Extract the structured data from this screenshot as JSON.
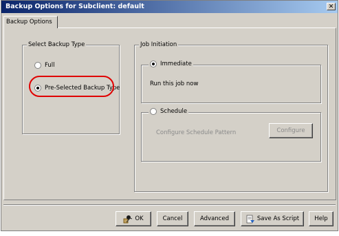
{
  "window": {
    "title": "Backup Options for Subclient: default",
    "close_glyph": "✕"
  },
  "tabs": [
    {
      "label": "Backup Options"
    }
  ],
  "backup_type": {
    "legend": "Select Backup Type",
    "options": [
      {
        "label": "Full",
        "selected": false
      },
      {
        "label": "Pre-Selected Backup Type",
        "selected": true
      }
    ]
  },
  "job_initiation": {
    "legend": "Job Initiation",
    "immediate": {
      "label": "Immediate",
      "selected": true,
      "description": "Run this job now"
    },
    "schedule": {
      "label": "Schedule",
      "selected": false,
      "description": "Configure Schedule Pattern",
      "configure_label": "Configure"
    }
  },
  "buttons": {
    "ok": "OK",
    "cancel": "Cancel",
    "advanced": "Advanced",
    "save_as_script": "Save As Script",
    "help": "Help"
  },
  "icons": {
    "ok": "ok-icon",
    "save_as_script": "script-icon"
  },
  "colors": {
    "title_gradient_start": "#0a246a",
    "title_gradient_end": "#a6caf0",
    "highlight": "#e00000",
    "dialog_bg": "#d4d0c8"
  }
}
